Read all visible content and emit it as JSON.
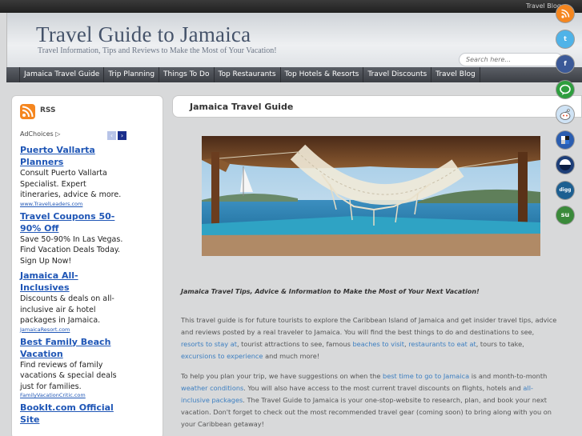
{
  "topbar": {
    "blog_link": "Travel Blog"
  },
  "header": {
    "title": "Travel Guide to Jamaica",
    "tagline": "Travel Information, Tips and Reviews to Make the Most of Your Vacation!",
    "search_placeholder": "Search here..."
  },
  "nav": {
    "items": [
      {
        "label": "Jamaica Travel Guide"
      },
      {
        "label": "Trip Planning"
      },
      {
        "label": "Things To Do"
      },
      {
        "label": "Top Restaurants"
      },
      {
        "label": "Top Hotels & Resorts"
      },
      {
        "label": "Travel Discounts"
      },
      {
        "label": "Travel Blog"
      }
    ]
  },
  "sidebar": {
    "rss_label": "RSS",
    "ad_choices": "AdChoices",
    "ads": [
      {
        "title": "Puerto Vallarta Planners",
        "desc": "Consult Puerto Vallarta Specialist. Expert itineraries, advice & more.",
        "url": "www.TravelLeaders.com"
      },
      {
        "title": "Travel Coupons 50-90% Off",
        "desc": "Save 50-90% In Las Vegas. Find Vacation Deals Today. Sign Up Now!",
        "url": ""
      },
      {
        "title": "Jamaica All-Inclusives",
        "desc": "Discounts & deals on all-inclusive air & hotel packages in Jamaica.",
        "url": "JamaicaResort.com"
      },
      {
        "title": "Best Family Beach Vacation",
        "desc": "Find reviews of family vacations & special deals just for families.",
        "url": "FamilyVacationCritic.com"
      },
      {
        "title": "BookIt.com Official Site",
        "desc": "",
        "url": ""
      }
    ]
  },
  "main": {
    "page_title": "Jamaica Travel Guide",
    "heading": "Jamaica Travel Tips, Advice & Information to Make the Most of Your Next Vacation!",
    "p1": {
      "t1": "This travel guide is for future tourists to explore the Caribbean Island of Jamaica and get insider travel tips, advice and reviews posted by a real traveler to Jamaica. You will find the best things to do and destinations to see, ",
      "l1": "resorts to stay at",
      "t2": ", tourist attractions to see, famous ",
      "l2": "beaches to visit",
      "t3": ", ",
      "l3": "restaurants to eat at",
      "t4": ", tours to take, ",
      "l4": "excursions to experience",
      "t5": " and much more!"
    },
    "p2": {
      "t1": "To help you plan your trip, we have suggestions on when the ",
      "l1": "best time to go to Jamaica",
      "t2": " is and month-to-month ",
      "l2": "weather conditions",
      "t3": ". You will also have access to the most current travel discounts on flights, hotels and ",
      "l3": "all-inclusive packages",
      "t4": ". The Travel Guide to Jamaica is your one-stop-website to research, plan, and book your next vacation. Don't forget to check out the most recommended travel gear (coming soon) to bring along with you on your Caribbean getaway!"
    }
  },
  "social": [
    {
      "name": "rss-icon",
      "glyph": "",
      "color": "#f5861f"
    },
    {
      "name": "twitter-icon",
      "glyph": "t",
      "color": "#4fb3e8"
    },
    {
      "name": "facebook-icon",
      "glyph": "f",
      "color": "#3b5998"
    },
    {
      "name": "chat-icon",
      "glyph": "",
      "color": "#2e9e3e"
    },
    {
      "name": "reddit-icon",
      "glyph": "",
      "color": "#cfe3f5"
    },
    {
      "name": "delicious-icon",
      "glyph": "",
      "color": "#2a5db0"
    },
    {
      "name": "mixx-icon",
      "glyph": "",
      "color": "#1d3e78"
    },
    {
      "name": "digg-icon",
      "glyph": "digg",
      "color": "#1c5f91"
    },
    {
      "name": "stumbleupon-icon",
      "glyph": "su",
      "color": "#3a8a3a"
    }
  ],
  "colors": {
    "accent_link": "#3d7fc1",
    "ad_link": "#1f56b6",
    "nav_bg": "#44474d"
  }
}
